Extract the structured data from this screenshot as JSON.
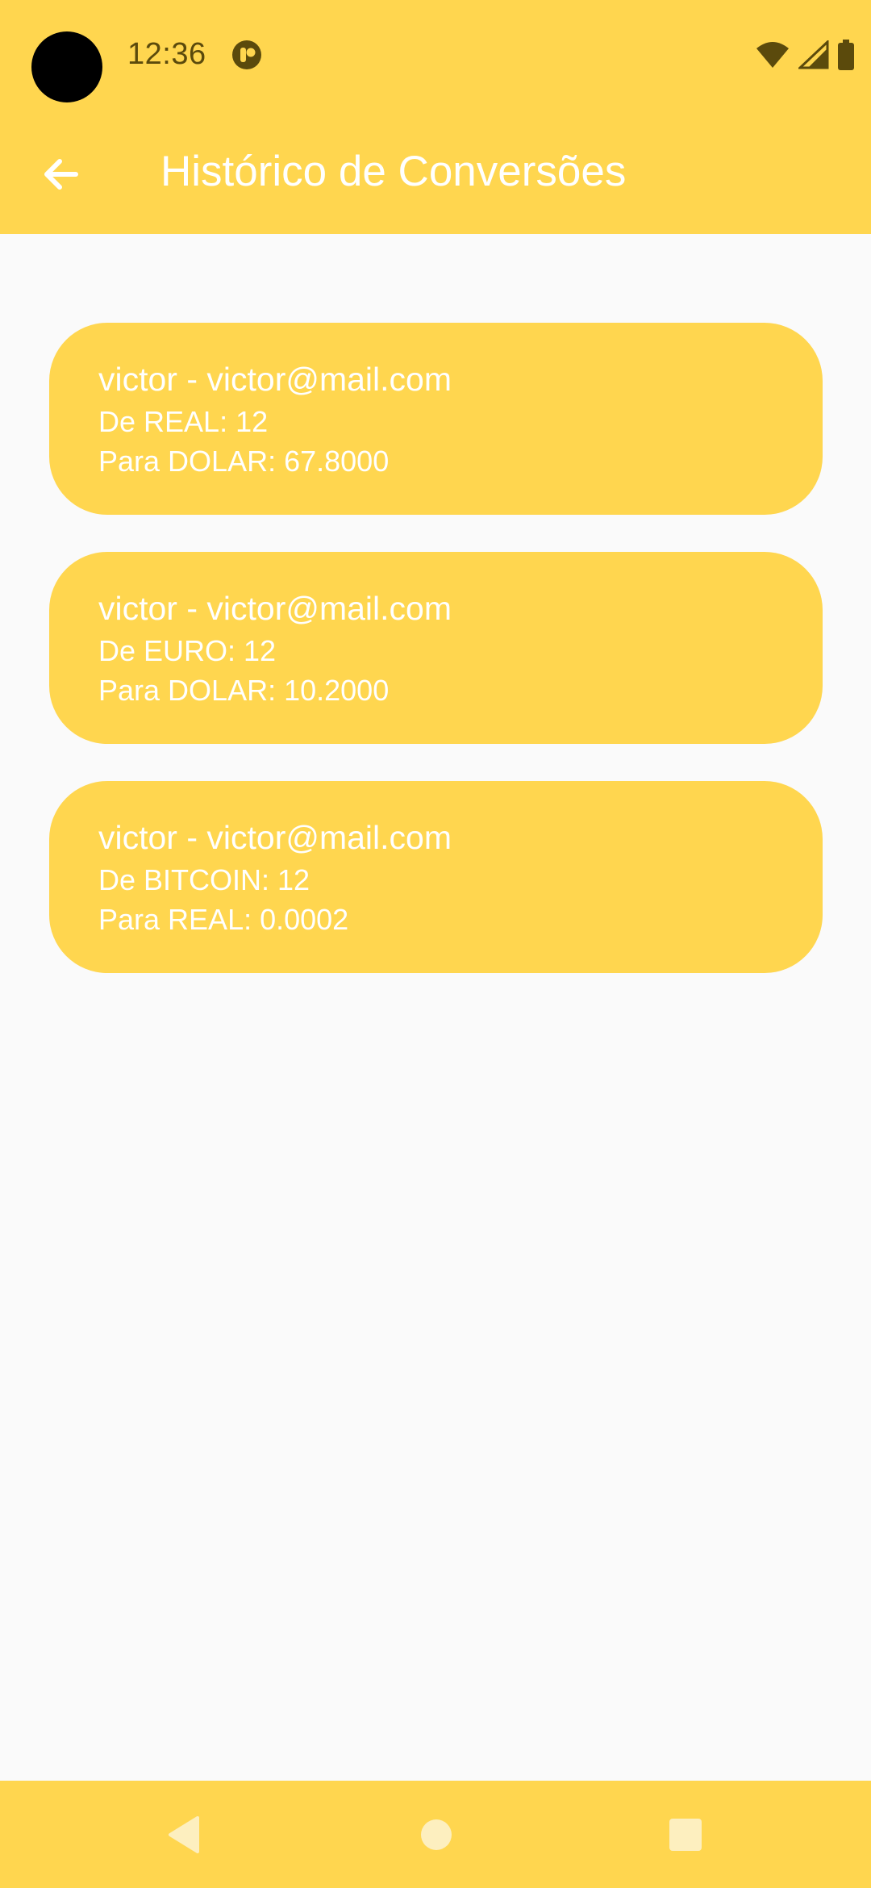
{
  "status_bar": {
    "time": "12:36",
    "notification_icon": "app-notification-icon",
    "icons": [
      "wifi-icon",
      "signal-icon",
      "battery-icon"
    ]
  },
  "app_bar": {
    "back_icon": "arrow-back-icon",
    "title": "Histórico de Conversões"
  },
  "conversions": [
    {
      "user": "victor - victor@mail.com",
      "from": "De REAL: 12",
      "to": "Para DOLAR: 67.8000"
    },
    {
      "user": "victor - victor@mail.com",
      "from": "De EURO: 12",
      "to": "Para DOLAR: 10.2000"
    },
    {
      "user": "victor - victor@mail.com",
      "from": "De BITCOIN: 12",
      "to": "Para REAL: 0.0002"
    }
  ],
  "nav_bar": {
    "icons": [
      "nav-back-icon",
      "nav-home-icon",
      "nav-recents-icon"
    ]
  },
  "colors": {
    "accent": "#ffd64f",
    "background": "#fafafa",
    "text_on_accent": "#ffffff",
    "status_text": "#5b4a0c"
  }
}
